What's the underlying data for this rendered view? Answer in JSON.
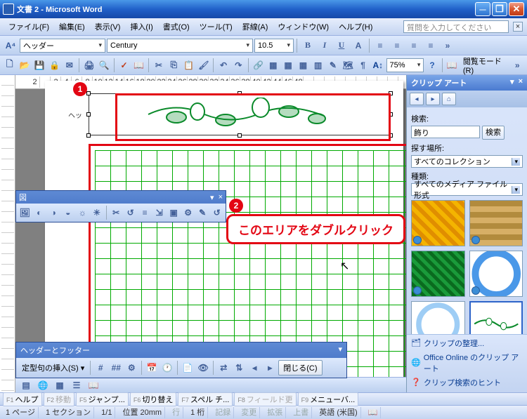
{
  "window": {
    "title": "文書 2 - Microsoft Word"
  },
  "menu": {
    "file": "ファイル(F)",
    "edit": "編集(E)",
    "view": "表示(V)",
    "insert": "挿入(I)",
    "format": "書式(O)",
    "tools": "ツール(T)",
    "table": "罫線(A)",
    "window": "ウィンドウ(W)",
    "help": "ヘルプ(H)",
    "ask": "質問を入力してください"
  },
  "fmt": {
    "style": "ヘッダー",
    "font": "Century",
    "size": "10.5",
    "zoom": "75%",
    "reading": "閲覧モード(R)"
  },
  "annotations": {
    "b1": "1",
    "b2": "2",
    "callout": "このエリアをダブルクリック"
  },
  "header_label": "ヘッ",
  "pic_toolbar": {
    "title": "図"
  },
  "hf_toolbar": {
    "title": "ヘッダーとフッター",
    "autotext": "定型句の挿入(S)",
    "close": "閉じる(C)"
  },
  "clipart": {
    "title": "クリップ アート",
    "search_label": "検索:",
    "search_value": "飾り",
    "search_btn": "検索",
    "location_label": "探す場所:",
    "location_value": "すべてのコレクション",
    "type_label": "種類:",
    "type_value": "すべてのメディア ファイル形式",
    "link1": "クリップの整理...",
    "link2": "Office Online のクリップ アート",
    "link3": "クリップ検索のヒント"
  },
  "fkeys": {
    "f1": "ヘルプ",
    "f2": "移動",
    "f5": "ジャンプ...",
    "f6": "切り替え",
    "f7": "スペル チ...",
    "f8": "フィールド更",
    "f9": "メニューバ..."
  },
  "status": {
    "page": "1 ページ",
    "section": "1 セクション",
    "pages": "1/1",
    "pos": "位置  20mm",
    "line": "行",
    "col": "1 桁",
    "rec": "記録",
    "trk": "変更",
    "ext": "拡張",
    "ovr": "上書",
    "lang": "英語 (米国)"
  }
}
